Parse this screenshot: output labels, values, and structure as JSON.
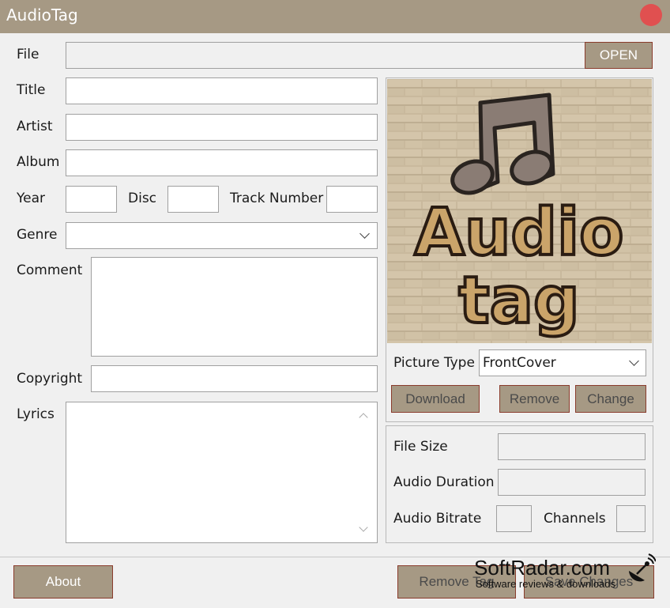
{
  "window": {
    "title": "AudioTag"
  },
  "fields": {
    "file_label": "File",
    "open_button": "OPEN",
    "title_label": "Title",
    "artist_label": "Artist",
    "album_label": "Album",
    "year_label": "Year",
    "disc_label": "Disc",
    "track_label": "Track Number",
    "genre_label": "Genre",
    "comment_label": "Comment",
    "copyright_label": "Copyright",
    "lyrics_label": "Lyrics"
  },
  "picture": {
    "cover_text_line1": "Audio",
    "cover_text_line2": "tag",
    "type_label": "Picture Type",
    "type_value": "FrontCover",
    "download_button": "Download",
    "remove_button": "Remove",
    "change_button": "Change"
  },
  "info": {
    "file_size_label": "File Size",
    "duration_label": "Audio Duration",
    "bitrate_label": "Audio Bitrate",
    "channels_label": "Channels"
  },
  "footer": {
    "about_button": "About",
    "remove_tag_button": "Remove Tag",
    "save_changes_button": "Save Changes"
  },
  "watermark": {
    "title": "SoftRadar.com",
    "subtitle": "Software reviews & downloads"
  },
  "colors": {
    "accent": "#a69984",
    "button_border": "#8a3c2c",
    "close": "#e05050"
  }
}
